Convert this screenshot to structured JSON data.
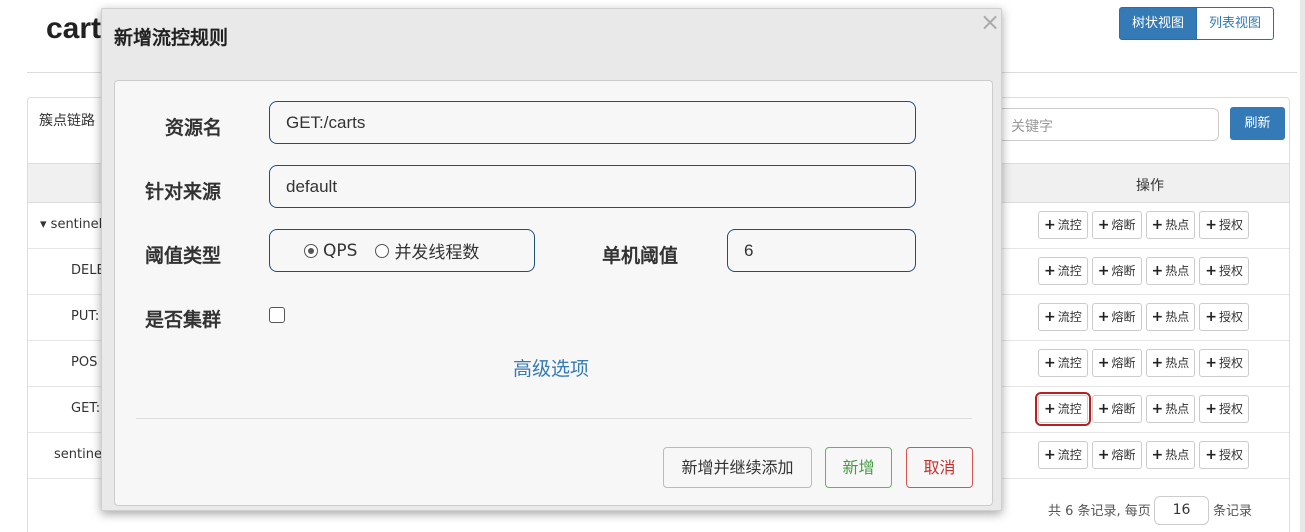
{
  "page": {
    "title": "carts",
    "view_tree": "树状视图",
    "view_list": "列表视图",
    "panel_label": "簇点链路",
    "search_placeholder": "关键字",
    "refresh": "刷新",
    "col_actions": "操作",
    "actions": [
      "流控",
      "熔断",
      "热点",
      "授权"
    ],
    "rows": [
      "sentinel_",
      "DELE",
      "PUT:",
      "POS",
      "GET:",
      "sentinel_"
    ],
    "pager_prefix": "共 6 条记录, 每页",
    "page_size": "16",
    "pager_suffix": "条记录"
  },
  "modal": {
    "title": "新增流控规则",
    "close": "×",
    "resource_label": "资源名",
    "resource_value": "GET:/carts",
    "source_label": "针对来源",
    "source_value": "default",
    "threshold_type_label": "阈值类型",
    "option_qps": "QPS",
    "option_threads": "并发线程数",
    "single_threshold_label": "单机阈值",
    "single_threshold_value": "6",
    "cluster_label": "是否集群",
    "advanced": "高级选项",
    "btn_continue": "新增并继续添加",
    "btn_add": "新增",
    "btn_cancel": "取消"
  }
}
